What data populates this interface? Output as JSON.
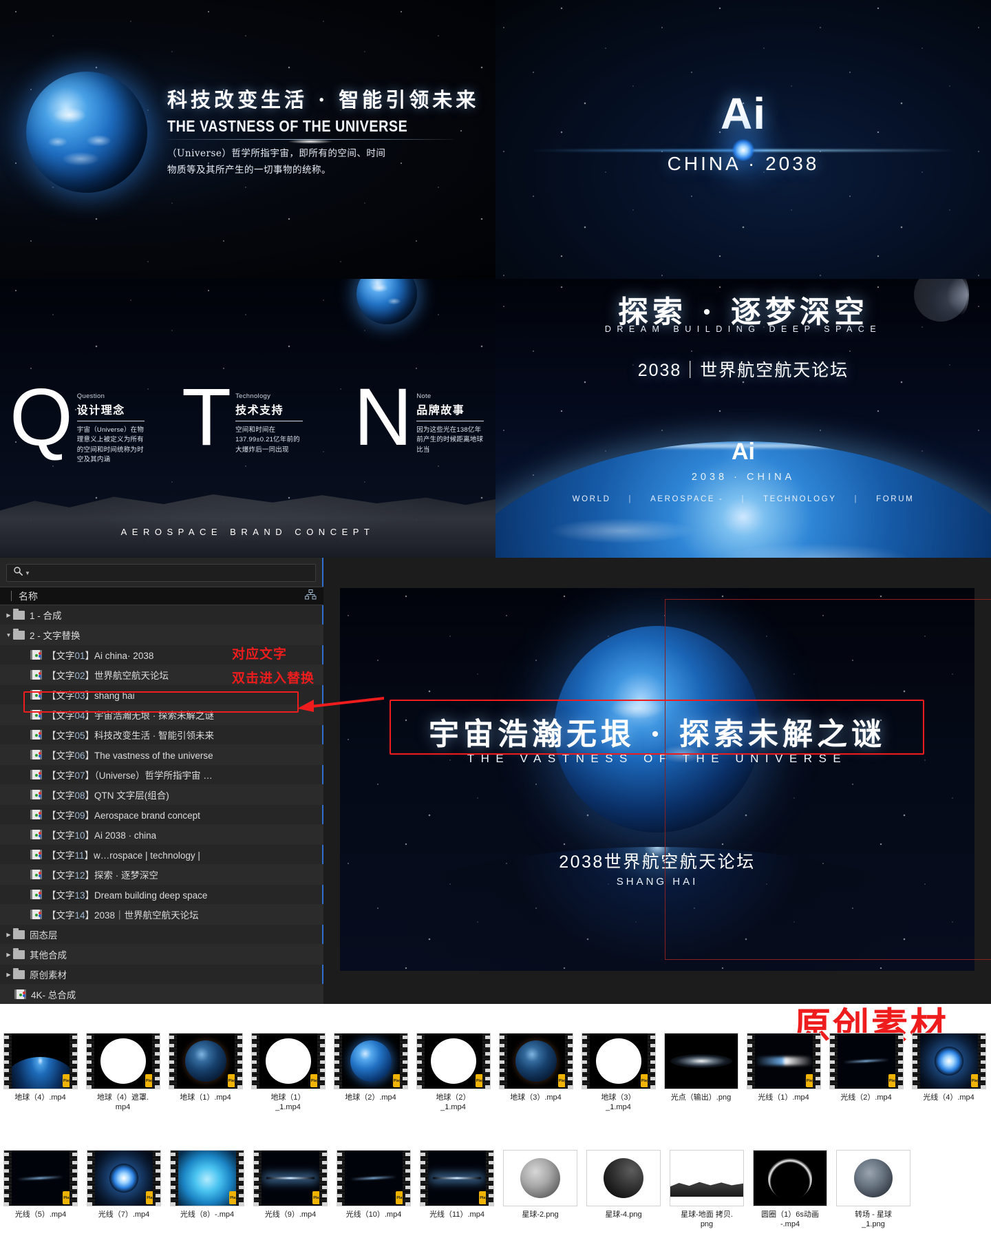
{
  "panel_a": {
    "headline_cn": "科技改变生活 · 智能引领未来",
    "headline_en": "THE VASTNESS OF THE UNIVERSE",
    "body_line1": "（Universe）哲学所指宇宙，即所有的空间、时间",
    "body_line2": "物质等及其所产生的一切事物的统称。"
  },
  "panel_b": {
    "logo": "Ai",
    "subtitle": "CHINA · 2038"
  },
  "panel_c": {
    "footer": "AEROSPACE BRAND CONCEPT",
    "columns": [
      {
        "letter": "Q",
        "eng": "Question",
        "cn": "设计理念",
        "body": "宇宙（Universe）在物理意义上被定义为所有的空间和时间统称为时空及其内涵"
      },
      {
        "letter": "T",
        "eng": "Technology",
        "cn": "技术支持",
        "body": "空间和时间在137.99±0.21亿年前的大爆炸后一同出现"
      },
      {
        "letter": "N",
        "eng": "Note",
        "cn": "品牌故事",
        "body": "因为这些光在138亿年前产生的时候距离地球比当"
      }
    ]
  },
  "panel_d": {
    "headline_cn": "探索 · 逐梦深空",
    "headline_en": "DREAM BUILDING DEEP SPACE",
    "subtitle": "2038｜世界航空航天论坛",
    "logo": "Ai",
    "logo_sub": "2038 · CHINA",
    "nav": [
      "WORLD",
      "AEROSPACE -",
      "TECHNOLOGY",
      "FORUM"
    ],
    "nav_separator": "|"
  },
  "ae_panel": {
    "search_placeholder": "",
    "search_value": "",
    "column_header": "名称",
    "annotation_line1": "对应文字",
    "annotation_line2": "双击进入替换",
    "rows": [
      {
        "indent": 1,
        "type": "folder",
        "expanded": false,
        "label": "1 - 合成"
      },
      {
        "indent": 1,
        "type": "folder",
        "expanded": true,
        "label": "2 - 文字替换"
      },
      {
        "indent": 2,
        "type": "comp",
        "prefix": "【文字",
        "num": "01",
        "suffix": "】",
        "label": "Ai   china· 2038"
      },
      {
        "indent": 2,
        "type": "comp",
        "prefix": "【文字",
        "num": "02",
        "suffix": "】",
        "label": "世界航空航天论坛"
      },
      {
        "indent": 2,
        "type": "comp",
        "prefix": "【文字",
        "num": "03",
        "suffix": "】",
        "label": "shang hai"
      },
      {
        "indent": 2,
        "type": "comp",
        "prefix": "【文字",
        "num": "04",
        "suffix": "】",
        "label": "宇宙浩瀚无垠 · 探索未解之谜",
        "selected": true
      },
      {
        "indent": 2,
        "type": "comp",
        "prefix": "【文字",
        "num": "05",
        "suffix": "】",
        "label": "科技改变生活 · 智能引领未来"
      },
      {
        "indent": 2,
        "type": "comp",
        "prefix": "【文字",
        "num": "06",
        "suffix": "】",
        "label": "The vastness of the universe"
      },
      {
        "indent": 2,
        "type": "comp",
        "prefix": "【文字",
        "num": "07",
        "suffix": "】",
        "label": "（Universe）哲学所指宇宙 …"
      },
      {
        "indent": 2,
        "type": "comp",
        "prefix": "【文字",
        "num": "08",
        "suffix": "】",
        "label": "QTN 文字层(组合)"
      },
      {
        "indent": 2,
        "type": "comp",
        "prefix": "【文字",
        "num": "09",
        "suffix": "】",
        "label": "Aerospace brand concept"
      },
      {
        "indent": 2,
        "type": "comp",
        "prefix": "【文字",
        "num": "10",
        "suffix": "】",
        "label": "Ai   2038 ·  china"
      },
      {
        "indent": 2,
        "type": "comp",
        "prefix": "【文字",
        "num": "11",
        "suffix": "】",
        "label": "w…rospace      |      technology      |"
      },
      {
        "indent": 2,
        "type": "comp",
        "prefix": "【文字",
        "num": "12",
        "suffix": "】",
        "label": "探索 · 逐梦深空"
      },
      {
        "indent": 2,
        "type": "comp",
        "prefix": "【文字",
        "num": "13",
        "suffix": "】",
        "label": "Dream building deep space"
      },
      {
        "indent": 2,
        "type": "comp",
        "prefix": "【文字",
        "num": "14",
        "suffix": "】",
        "label": "2038｜世界航空航天论坛"
      },
      {
        "indent": 1,
        "type": "folder",
        "expanded": false,
        "label": "固态层"
      },
      {
        "indent": 1,
        "type": "folder",
        "expanded": false,
        "label": "其他合成"
      },
      {
        "indent": 1,
        "type": "folder",
        "expanded": false,
        "label": "原创素材"
      },
      {
        "indent": 1,
        "type": "comp",
        "label": "4K- 总合成",
        "root": true
      }
    ]
  },
  "preview": {
    "title_cn": "宇宙浩瀚无垠 · 探索未解之谜",
    "title_en": "THE VASTNESS OF THE UNIVERSE",
    "footer_cn": "2038世界航空航天论坛",
    "footer_en": "SHANG HAI"
  },
  "assets": {
    "annotation": "原创素材",
    "row1": [
      {
        "caption": "地球（4）.mp4",
        "art": "art-earth-limb",
        "film": true,
        "badge": "Player"
      },
      {
        "caption": "地球（4）遮罩.\nmp4",
        "art": "art-white-disc",
        "film": true,
        "badge": "Player"
      },
      {
        "caption": "地球（1）.mp4",
        "art": "art-dark-globe",
        "film": true,
        "badge": "Player"
      },
      {
        "caption": "地球（1）\n_1.mp4",
        "art": "art-white-disc",
        "film": true,
        "badge": "Player"
      },
      {
        "caption": "地球（2）.mp4",
        "art": "art-blue-globe",
        "film": true,
        "badge": "Player"
      },
      {
        "caption": "地球（2）\n_1.mp4",
        "art": "art-white-disc",
        "film": true,
        "badge": "Player"
      },
      {
        "caption": "地球（3）.mp4",
        "art": "art-dark-globe",
        "film": true,
        "badge": "Player"
      },
      {
        "caption": "地球（3）\n_1.mp4",
        "art": "art-white-disc",
        "film": true,
        "badge": "Player"
      },
      {
        "caption": "光点（输出）.png",
        "art": "art-flare-oval",
        "film": false,
        "badge": ""
      },
      {
        "caption": "光线（1）.mp4",
        "art": "art-beam",
        "film": true,
        "badge": "Player"
      },
      {
        "caption": "光线（2）.mp4",
        "art": "art-streak",
        "film": true,
        "badge": "Player"
      },
      {
        "caption": "光线（4）.mp4",
        "art": "art-beam2",
        "film": true,
        "badge": "Player"
      }
    ],
    "row2": [
      {
        "caption": "光线（5）.mp4",
        "art": "art-streak",
        "film": true,
        "badge": "Player"
      },
      {
        "caption": "光线（7）.mp4",
        "art": "art-beam2",
        "film": true,
        "badge": "Player"
      },
      {
        "caption": "光线（8）-.mp4",
        "art": "art-cyan",
        "film": true,
        "badge": "Player"
      },
      {
        "caption": "光线（9）.mp4",
        "art": "art-starburst",
        "film": true,
        "badge": "Player"
      },
      {
        "caption": "光线（10）.mp4",
        "art": "art-streak",
        "film": true,
        "badge": "Player"
      },
      {
        "caption": "光线（11）.mp4",
        "art": "art-starburst",
        "film": true,
        "badge": "Player"
      },
      {
        "caption": "星球-2.png",
        "art": "art-moon-grey",
        "film": false,
        "badge": ""
      },
      {
        "caption": "星球-4.png",
        "art": "art-moon-dark",
        "film": false,
        "badge": ""
      },
      {
        "caption": "星球-地面 拷贝.\npng",
        "art": "art-ground",
        "film": false,
        "badge": ""
      },
      {
        "caption": "圆圈（1）6s动画\n-.mp4",
        "art": "art-ring",
        "film": false,
        "badge": ""
      },
      {
        "caption": "转场 - 星球\n_1.png",
        "art": "art-transition",
        "film": false,
        "badge": ""
      }
    ]
  }
}
